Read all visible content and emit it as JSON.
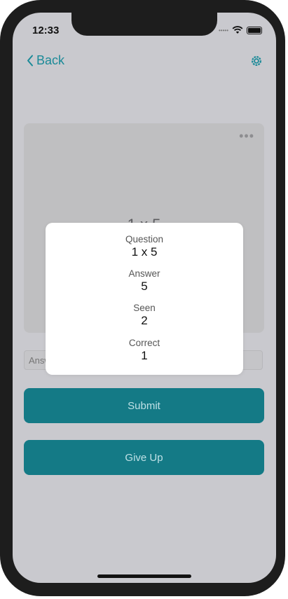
{
  "status_bar": {
    "time": "12:33",
    "signal_icon": "signal-dots-icon",
    "wifi_icon": "wifi-icon",
    "battery_icon": "battery-icon"
  },
  "nav": {
    "back_label": "Back",
    "back_icon": "chevron-left-icon",
    "settings_icon": "gear-icon",
    "accent_color": "#1b8a98"
  },
  "card": {
    "more_icon": "ellipsis-icon",
    "question_text": "1 x 5"
  },
  "answer_input": {
    "placeholder": "Answer"
  },
  "buttons": {
    "submit_label": "Submit",
    "give_up_label": "Give Up",
    "color": "#147a86"
  },
  "modal": {
    "items": [
      {
        "label": "Question",
        "value": "1 x 5"
      },
      {
        "label": "Answer",
        "value": "5"
      },
      {
        "label": "Seen",
        "value": "2"
      },
      {
        "label": "Correct",
        "value": "1"
      }
    ]
  }
}
